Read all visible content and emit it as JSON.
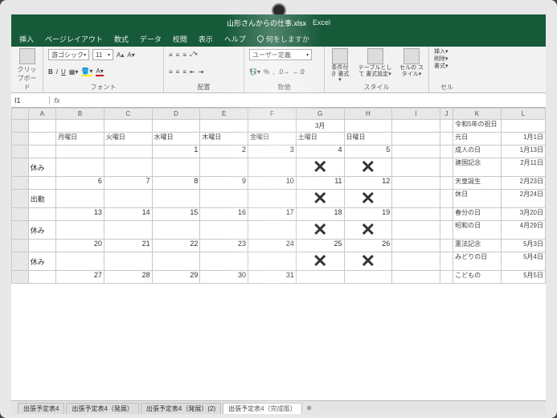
{
  "titlebar": {
    "filename": "山形さんからの仕事.xlsx",
    "app": "Excel"
  },
  "tabs": {
    "items": [
      "挿入",
      "ページレイアウト",
      "数式",
      "データ",
      "校閲",
      "表示",
      "ヘルプ"
    ],
    "tellme": "何をしますか"
  },
  "ribbon": {
    "font": {
      "name": "游ゴシック",
      "size": "11",
      "group": "フォント",
      "bold": "B",
      "italic": "I",
      "underline": "U"
    },
    "align": {
      "group": "配置"
    },
    "number": {
      "format": "ユーザー定義",
      "group": "数値",
      "pct": "%",
      "comma": ","
    },
    "styles": {
      "condfmt": "条件付き\n書式▾",
      "tblfmt": "テーブルとして\n書式設定▾",
      "cellstyle": "セルの\nスタイル▾",
      "group": "スタイル"
    },
    "cells": {
      "insert": "挿入▾",
      "delete": "削除▾",
      "format": "書式▾",
      "group": "セル"
    },
    "clipboard": {
      "group": "クリップボード"
    }
  },
  "fx": {
    "namebox": "I1",
    "value": ""
  },
  "cols": [
    "A",
    "B",
    "C",
    "D",
    "E",
    "F",
    "G",
    "H",
    "I",
    "J",
    "K",
    "L"
  ],
  "cal": {
    "month_hdr": "3月",
    "days": [
      "月曜日",
      "火曜日",
      "水曜日",
      "木曜日",
      "金曜日",
      "土曜日",
      "日曜日"
    ],
    "rows": [
      {
        "label": "",
        "n": [
          "",
          "",
          "1",
          "2",
          "3",
          "4",
          "5"
        ]
      },
      {
        "label": "休み",
        "x": [
          false,
          false,
          false,
          false,
          false,
          true,
          true
        ]
      },
      {
        "label": "",
        "n": [
          "6",
          "7",
          "8",
          "9",
          "10",
          "11",
          "12"
        ]
      },
      {
        "label": "出勤",
        "x": [
          false,
          false,
          false,
          false,
          false,
          true,
          true
        ]
      },
      {
        "label": "",
        "n": [
          "13",
          "14",
          "15",
          "16",
          "17",
          "18",
          "19"
        ]
      },
      {
        "label": "休み",
        "x": [
          false,
          false,
          false,
          false,
          false,
          true,
          true
        ]
      },
      {
        "label": "",
        "n": [
          "20",
          "21",
          "22",
          "23",
          "24",
          "25",
          "26"
        ]
      },
      {
        "label": "休み",
        "x": [
          false,
          false,
          false,
          false,
          false,
          true,
          true
        ]
      },
      {
        "label": "",
        "n": [
          "27",
          "28",
          "29",
          "30",
          "31",
          "",
          ""
        ]
      }
    ],
    "side": {
      "title": "令和5年の祝日",
      "rows": [
        [
          "元日",
          "1月1日"
        ],
        [
          "成人の日",
          "1月13日"
        ],
        [
          "",
          ""
        ],
        [
          "建国記念",
          "2月11日"
        ],
        [
          "",
          ""
        ],
        [
          "天皇誕生",
          "2月23日"
        ],
        [
          "",
          ""
        ],
        [
          "休日",
          "2月24日"
        ],
        [
          "",
          ""
        ],
        [
          "春分の日",
          "3月20日"
        ],
        [
          "",
          ""
        ],
        [
          "昭和の日",
          "4月29日"
        ],
        [
          "",
          ""
        ],
        [
          "憲法記念",
          "5月3日"
        ],
        [
          "",
          ""
        ],
        [
          "みどりの日",
          "5月4日"
        ],
        [
          "",
          ""
        ],
        [
          "こどもの",
          "5月5日"
        ]
      ]
    }
  },
  "sheettabs": {
    "items": [
      "出張予定表4",
      "出張予定表4（発展）",
      "出張予定表4（発展）(2)",
      "出張予定表4（完成版）"
    ]
  }
}
